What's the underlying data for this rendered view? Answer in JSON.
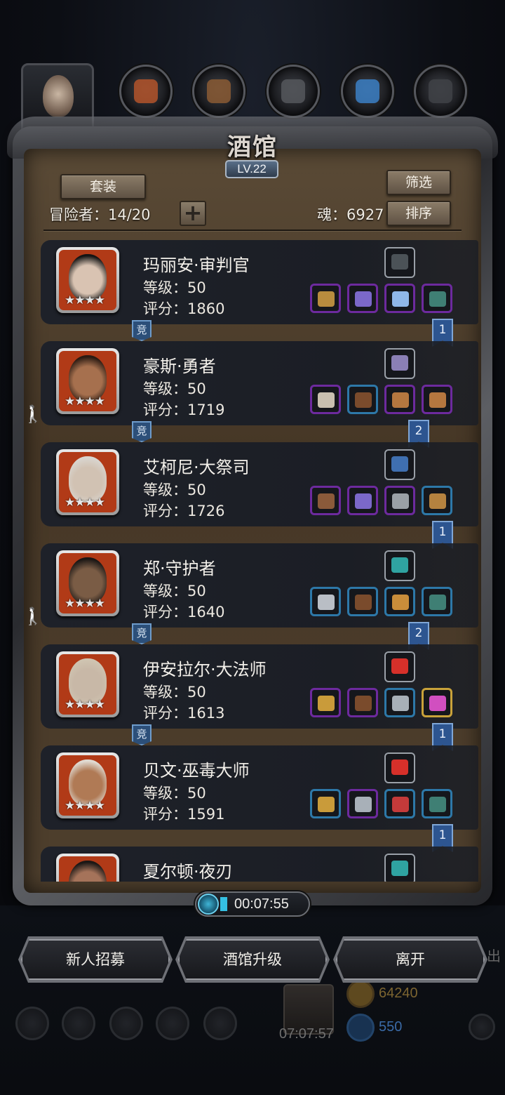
{
  "header": {
    "title": "酒馆",
    "level": "LV.22",
    "suit_button": "套装",
    "filter_button": "筛选",
    "sort_button": "排序",
    "adventurers_label": "冒险者：14/20",
    "add_button": "+",
    "soul_label": "魂：6927"
  },
  "top_slots": [
    "portrait",
    "cloth-icon",
    "wood-icon",
    "stone-icon",
    "crystal-icon",
    "iron-icon"
  ],
  "heroes": [
    {
      "name": "玛丽安·审判官",
      "level": "等级：50",
      "score": "评分：1860",
      "stars": "★★★★",
      "jing": "竞",
      "rank": "1",
      "walking": false,
      "face": "#d9c3b2",
      "hair": "#141414",
      "equip_top": "#4b5257",
      "equip": [
        [
          "#6d2a9e",
          "#b88c3e"
        ],
        [
          "#6d2a9e",
          "#7b68c9"
        ],
        [
          "#6d2a9e",
          "#8fb7e8"
        ],
        [
          "#6d2a9e",
          "#3f7f74"
        ]
      ]
    },
    {
      "name": "豪斯·勇者",
      "level": "等级：50",
      "score": "评分：1719",
      "stars": "★★★★",
      "jing": "竞",
      "rank": "2",
      "walking": true,
      "face": "#a6704e",
      "hair": "#2a1a12",
      "equip_top": "#8a7fb5",
      "equip": [
        [
          "#6d2a9e",
          "#c9c0b0"
        ],
        [
          "#2d78a8",
          "#7a4b2c"
        ],
        [
          "#6d2a9e",
          "#b5773f"
        ],
        [
          "#6d2a9e",
          "#b5773f"
        ]
      ]
    },
    {
      "name": "艾柯尼·大祭司",
      "level": "等级：50",
      "score": "评分：1726",
      "stars": "★★★★",
      "jing": "",
      "rank": "1",
      "walking": false,
      "face": "#d1c2b3",
      "hair": "#d9d5cf",
      "equip_top": "#3f6fb0",
      "equip": [
        [
          "#6d2a9e",
          "#8a5a3a"
        ],
        [
          "#6d2a9e",
          "#7b68c9"
        ],
        [
          "#6d2a9e",
          "#9aa0a6"
        ],
        [
          "#2d78a8",
          "#b5823f"
        ]
      ]
    },
    {
      "name": "郑·守护者",
      "level": "等级：50",
      "score": "评分：1640",
      "stars": "★★★★",
      "jing": "竞",
      "rank": "2",
      "walking": true,
      "face": "#7a5c45",
      "hair": "#1b1715",
      "equip_top": "#2fa3a1",
      "equip": [
        [
          "#2d78a8",
          "#b9bec5"
        ],
        [
          "#2d78a8",
          "#7a4b2c"
        ],
        [
          "#2d78a8",
          "#c98d3a"
        ],
        [
          "#2d78a8",
          "#3f7f74"
        ]
      ]
    },
    {
      "name": "伊安拉尔·大法师",
      "level": "等级：50",
      "score": "评分：1613",
      "stars": "★★★★",
      "jing": "竞",
      "rank": "1",
      "walking": false,
      "face": "#c8b8a7",
      "hair": "#cfc4b1",
      "equip_top": "#d6302a",
      "equip": [
        [
          "#6d2a9e",
          "#c99b3a"
        ],
        [
          "#6d2a9e",
          "#7a4b2c"
        ],
        [
          "#2d78a8",
          "#a8b0b8"
        ],
        [
          "#c9a23a",
          "#d14fc0"
        ]
      ]
    },
    {
      "name": "贝文·巫毒大师",
      "level": "等级：50",
      "score": "评分：1591",
      "stars": "★★★★",
      "jing": "",
      "rank": "1",
      "walking": false,
      "face": "#b07a55",
      "hair": "#e0dad2",
      "equip_top": "#d6302a",
      "equip": [
        [
          "#2d78a8",
          "#c99b3a"
        ],
        [
          "#6d2a9e",
          "#a8b0b8"
        ],
        [
          "#2d78a8",
          "#c43a3a"
        ],
        [
          "#2d78a8",
          "#3f7f74"
        ]
      ]
    },
    {
      "name": "夏尔顿·夜刃",
      "level": "",
      "score": "",
      "stars": "",
      "jing": "",
      "rank": "",
      "walking": false,
      "face": "#a5735a",
      "hair": "#1b1715",
      "equip_top": "#2fa3a1",
      "equip": []
    }
  ],
  "timer": "00:07:55",
  "bottom_buttons": {
    "recruit": "新人招募",
    "upgrade": "酒馆升级",
    "leave": "离开"
  },
  "background_hud": {
    "gold": "64240",
    "gems": "550",
    "gift_timer": "07:07:57",
    "side_text": "出"
  },
  "colors": {
    "accent_blue": "#2d5590",
    "epic": "#6d2a9e",
    "rare": "#2d78a8",
    "legend": "#c9a23a",
    "portrait_bg": "#b13a17"
  }
}
